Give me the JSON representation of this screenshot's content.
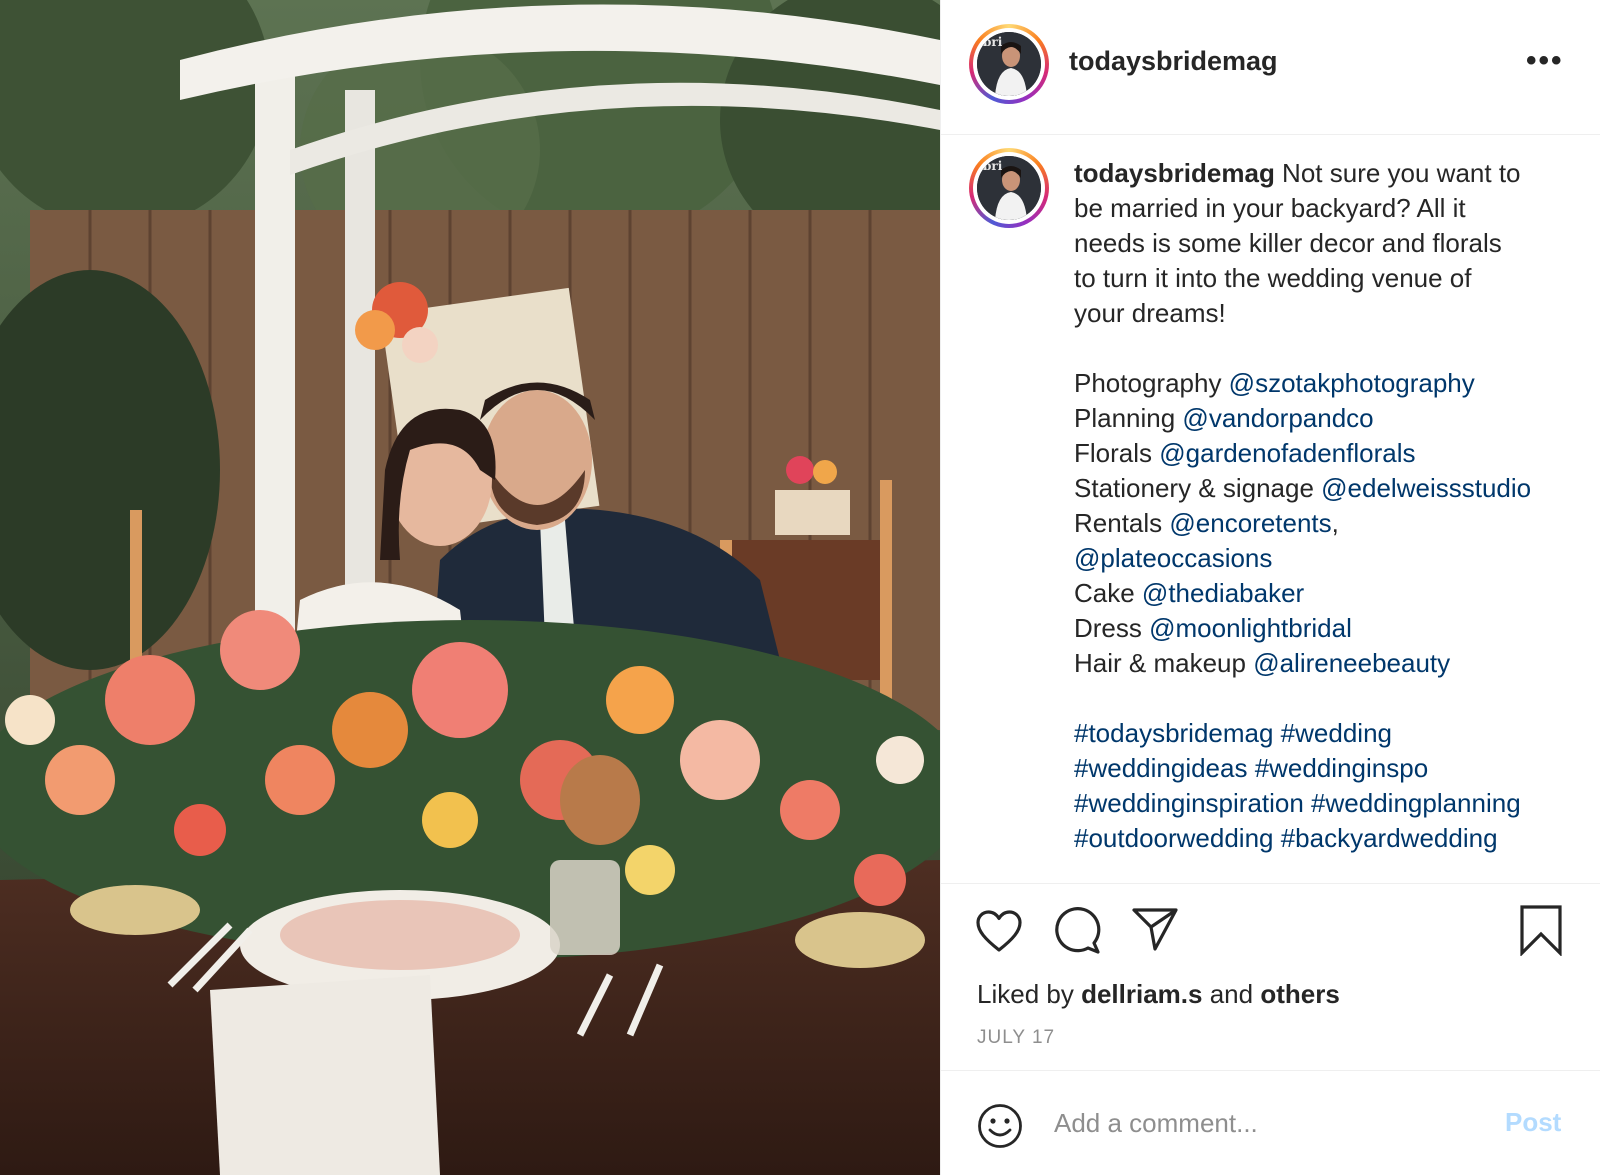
{
  "post": {
    "username": "todaysbridemag",
    "more_label": "•••",
    "photo_alt": "Bride and groom at a flower-covered table in a backyard"
  },
  "caption": {
    "username": "todaysbridemag",
    "intro_lines": [
      " Not sure you want to",
      "be married in your backyard? All it",
      "needs is some killer decor and florals",
      "to turn it into the wedding venue of",
      "your dreams!"
    ],
    "credits": [
      {
        "label": "Photography ",
        "handle": "@szotakphotography",
        "suffix": ""
      },
      {
        "label": "Planning ",
        "handle": "@vandorpandco",
        "suffix": ""
      },
      {
        "label": "Florals ",
        "handle": "@gardenofadenflorals",
        "suffix": ""
      },
      {
        "label": "Stationery & signage ",
        "handle": "@edelweissstudio",
        "suffix": ""
      },
      {
        "label": "Rentals ",
        "handle": "@encoretents",
        "suffix": ","
      },
      {
        "label": "",
        "handle": "@plateoccasions",
        "suffix": ""
      },
      {
        "label": "Cake ",
        "handle": "@thediabaker",
        "suffix": ""
      },
      {
        "label": "Dress ",
        "handle": "@moonlightbridal",
        "suffix": ""
      },
      {
        "label": "Hair & makeup ",
        "handle": "@alireneebeauty",
        "suffix": ""
      }
    ],
    "hashtag_lines": [
      "#todaysbridemag #wedding",
      "#weddingideas #weddinginspo",
      "#weddinginspiration #weddingplanning",
      "#outdoorwedding #backyardwedding"
    ]
  },
  "actions": {
    "icons": [
      "heart-icon",
      "comment-icon",
      "share-icon",
      "bookmark-icon"
    ],
    "liked_prefix": "Liked by ",
    "liked_user": "dellriam.s",
    "liked_middle": " and ",
    "liked_others": "others",
    "date": "JULY 17"
  },
  "comment": {
    "placeholder": "Add a comment...",
    "post_label": "Post",
    "emoji_icon": "smiley-icon"
  },
  "colors": {
    "link": "#00376b",
    "post_disabled": "#b3dbff",
    "muted": "#8e8e8e"
  }
}
